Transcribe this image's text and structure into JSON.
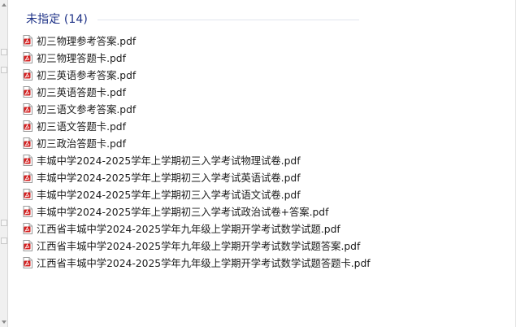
{
  "group": {
    "title": "未指定 (14)"
  },
  "files": [
    {
      "name": "初三物理参考答案.pdf",
      "icon": "pdf-icon"
    },
    {
      "name": "初三物理答题卡.pdf",
      "icon": "pdf-icon"
    },
    {
      "name": "初三英语参考答案.pdf",
      "icon": "pdf-icon"
    },
    {
      "name": "初三英语答题卡.pdf",
      "icon": "pdf-icon"
    },
    {
      "name": "初三语文参考答案.pdf",
      "icon": "pdf-icon"
    },
    {
      "name": "初三语文答题卡.pdf",
      "icon": "pdf-icon"
    },
    {
      "name": "初三政治答题卡.pdf",
      "icon": "pdf-icon"
    },
    {
      "name": "丰城中学2024-2025学年上学期初三入学考试物理试卷.pdf",
      "icon": "pdf-icon"
    },
    {
      "name": "丰城中学2024-2025学年上学期初三入学考试英语试卷.pdf",
      "icon": "pdf-icon"
    },
    {
      "name": "丰城中学2024-2025学年上学期初三入学考试语文试卷.pdf",
      "icon": "pdf-icon"
    },
    {
      "name": "丰城中学2024-2025学年上学期初三入学考试政治试卷+答案.pdf",
      "icon": "pdf-icon"
    },
    {
      "name": "江西省丰城中学2024-2025学年九年级上学期开学考试数学试题.pdf",
      "icon": "pdf-icon"
    },
    {
      "name": "江西省丰城中学2024-2025学年九年级上学期开学考试数学试题答案.pdf",
      "icon": "pdf-icon"
    },
    {
      "name": "江西省丰城中学2024-2025学年九年级上学期开学考试数学试题答题卡.pdf",
      "icon": "pdf-icon"
    }
  ],
  "colors": {
    "group_title": "#1e3287",
    "pdf_icon": "#d42020",
    "text": "#1a1a1a"
  }
}
